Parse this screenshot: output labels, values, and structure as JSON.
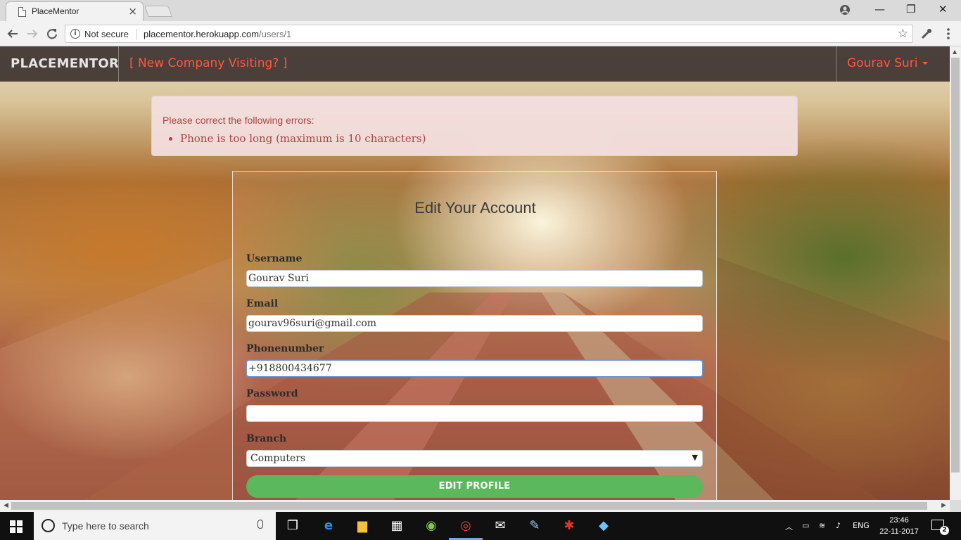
{
  "browser": {
    "tab_title": "PlaceMentor",
    "tab_close": "×",
    "security_label": "Not secure",
    "url_host": "placementor.herokuapp.com",
    "url_path": "/users/1",
    "back_icon": "arrow-left",
    "forward_icon": "arrow-right",
    "reload_icon": "reload",
    "bookmark_icon": "star",
    "window_controls": [
      "—",
      "❐",
      "✕"
    ]
  },
  "navbar": {
    "brand": "PLACEMENTOR",
    "company_link": "[ New Company Visiting? ]",
    "user_menu": "Gourav Suri",
    "link_color": "#ff5a3c"
  },
  "alert": {
    "heading": "Please correct the following errors:",
    "errors": [
      "Phone is too long (maximum is 10 characters)"
    ],
    "color": "#a94442",
    "background": "#f2dede"
  },
  "form": {
    "title": "Edit Your Account",
    "username_label": "Username",
    "username_value": "Gourav Suri",
    "email_label": "Email",
    "email_value": "gourav96suri@gmail.com",
    "phone_label": "Phonenumber",
    "phone_value": "+918800434677",
    "password_label": "Password",
    "password_value": "",
    "branch_label": "Branch",
    "branch_value": "Computers",
    "submit_label": "EDIT PROFILE",
    "submit_color": "#5cb85c"
  },
  "taskbar": {
    "search_placeholder": "Type here to search",
    "language": "ENG",
    "time": "23:46",
    "date": "22-11-2017",
    "notification_count": "2"
  }
}
